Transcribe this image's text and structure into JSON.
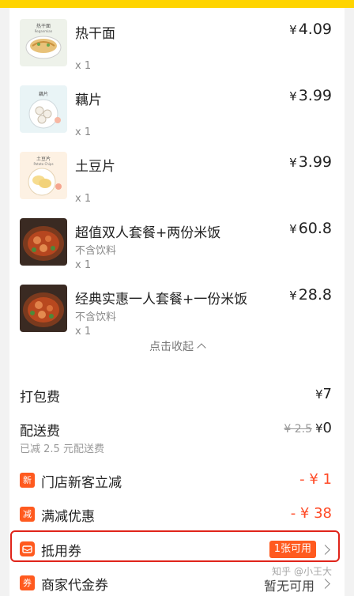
{
  "items": [
    {
      "name": "热干面",
      "sub": "",
      "qty": "x 1",
      "price_symbol": "¥",
      "price": "4.09",
      "thumb_text": "热干面",
      "thumb_text2": "Reganmian"
    },
    {
      "name": "藕片",
      "sub": "",
      "qty": "x 1",
      "price_symbol": "¥",
      "price": "3.99",
      "thumb_text": "藕片",
      "thumb_text2": ""
    },
    {
      "name": "土豆片",
      "sub": "",
      "qty": "x 1",
      "price_symbol": "¥",
      "price": "3.99",
      "thumb_text": "土豆片",
      "thumb_text2": "Potato Chips"
    },
    {
      "name": "超值双人套餐+两份米饭",
      "sub": "不含饮料",
      "qty": "x 1",
      "price_symbol": "¥",
      "price": "60.8",
      "thumb_text": "",
      "thumb_text2": ""
    },
    {
      "name": "经典实惠一人套餐+一份米饭",
      "sub": "不含饮料",
      "qty": "x 1",
      "price_symbol": "¥",
      "price": "28.8",
      "thumb_text": "",
      "thumb_text2": ""
    }
  ],
  "collapse_label": "点击收起",
  "packing_fee": {
    "label": "打包费",
    "symbol": "¥",
    "value": "7"
  },
  "delivery_fee": {
    "label": "配送费",
    "original": "¥ 2.5",
    "symbol": "¥",
    "value": "0",
    "note": "已减 2.5 元配送费"
  },
  "new_customer": {
    "badge": "新",
    "label": "门店新客立减",
    "value": "- ¥ 1"
  },
  "full_reduction": {
    "badge": "减",
    "label": "满减优惠",
    "value": "- ¥ 38"
  },
  "voucher": {
    "label": "抵用券",
    "pill": "1张可用"
  },
  "merchant_voucher": {
    "badge": "券",
    "label": "商家代金券",
    "value": "暂无可用",
    "watermark": "知乎 @小王大"
  },
  "colors": {
    "accent": "#ff5a1f",
    "top_bar": "#ffd400",
    "highlight_border": "#e0241a"
  },
  "icons": [
    "chevron-up-icon",
    "chevron-right-icon",
    "voucher-icon"
  ]
}
